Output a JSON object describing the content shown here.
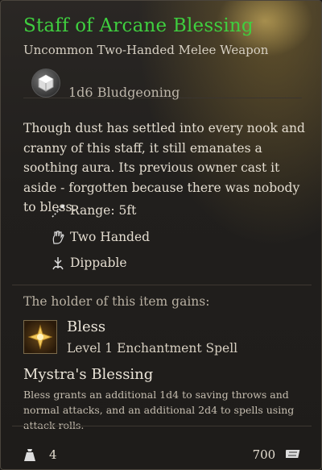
{
  "item": {
    "name": "Staff of Arcane Blessing",
    "type": "Uncommon Two-Handed Melee Weapon",
    "damage": "1d6 Bludgeoning",
    "description": "Though dust has settled into every nook and cranny of this staff, it still emanates a soothing aura. Its previous owner cast it aside - forgotten because there was nobody to bless.",
    "properties": [
      {
        "icon": "range-icon",
        "label": "Range: 5ft"
      },
      {
        "icon": "two-handed-icon",
        "label": "Two Handed"
      },
      {
        "icon": "dippable-icon",
        "label": "Dippable"
      }
    ]
  },
  "grants": {
    "header": "The holder of this item gains:",
    "spell": {
      "name": "Bless",
      "level": "Level 1 Enchantment Spell",
      "icon": "bless-spell-icon"
    },
    "passive": {
      "name": "Mystra's Blessing",
      "description": "Bless grants an additional 1d4 to saving throws and normal attacks, and an additional 2d4 to spells using attack rolls."
    }
  },
  "footer": {
    "weight": "4",
    "price": "700",
    "weight_icon": "weight-icon",
    "price_icon": "gold-icon"
  },
  "colors": {
    "title": "#3fcf3f",
    "text": "#e4ddd0",
    "muted": "#b8b0a2"
  }
}
